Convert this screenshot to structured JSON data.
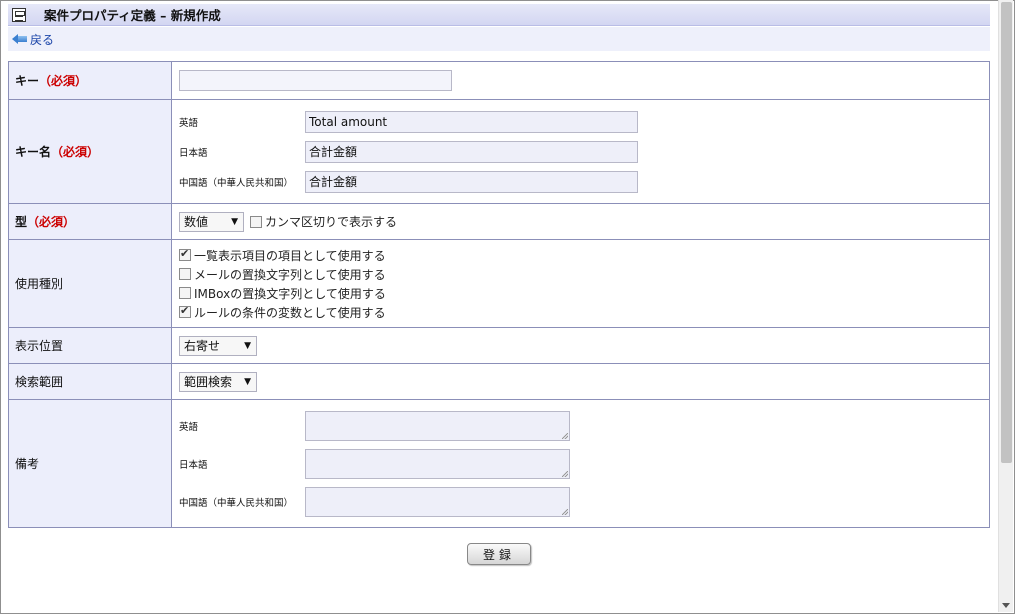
{
  "header": {
    "title": "案件プロパティ定義 – 新規作成",
    "back_label": "戻る"
  },
  "form": {
    "key": {
      "label": "キー",
      "required": "（必須）",
      "value": ""
    },
    "key_name": {
      "label": "キー名",
      "required": "（必須）",
      "languages": [
        {
          "label": "英語",
          "value": "Total amount"
        },
        {
          "label": "日本語",
          "value": "合計金額"
        },
        {
          "label": "中国語（中華人民共和国）",
          "value": "合計金額"
        }
      ]
    },
    "type": {
      "label": "型",
      "required": "（必須）",
      "selected": "数値",
      "comma_label": "カンマ区切りで表示する",
      "comma_checked": false
    },
    "usage": {
      "label": "使用種別",
      "options": [
        {
          "label": "一覧表示項目の項目として使用する",
          "checked": true
        },
        {
          "label": "メールの置換文字列として使用する",
          "checked": false
        },
        {
          "label": "IMBoxの置換文字列として使用する",
          "checked": false
        },
        {
          "label": "ルールの条件の変数として使用する",
          "checked": true
        }
      ]
    },
    "position": {
      "label": "表示位置",
      "selected": "右寄せ"
    },
    "search": {
      "label": "検索範囲",
      "selected": "範囲検索"
    },
    "notes": {
      "label": "備考",
      "languages": [
        {
          "label": "英語",
          "value": ""
        },
        {
          "label": "日本語",
          "value": ""
        },
        {
          "label": "中国語（中華人民共和国）",
          "value": ""
        }
      ]
    }
  },
  "submit_label": "登録"
}
